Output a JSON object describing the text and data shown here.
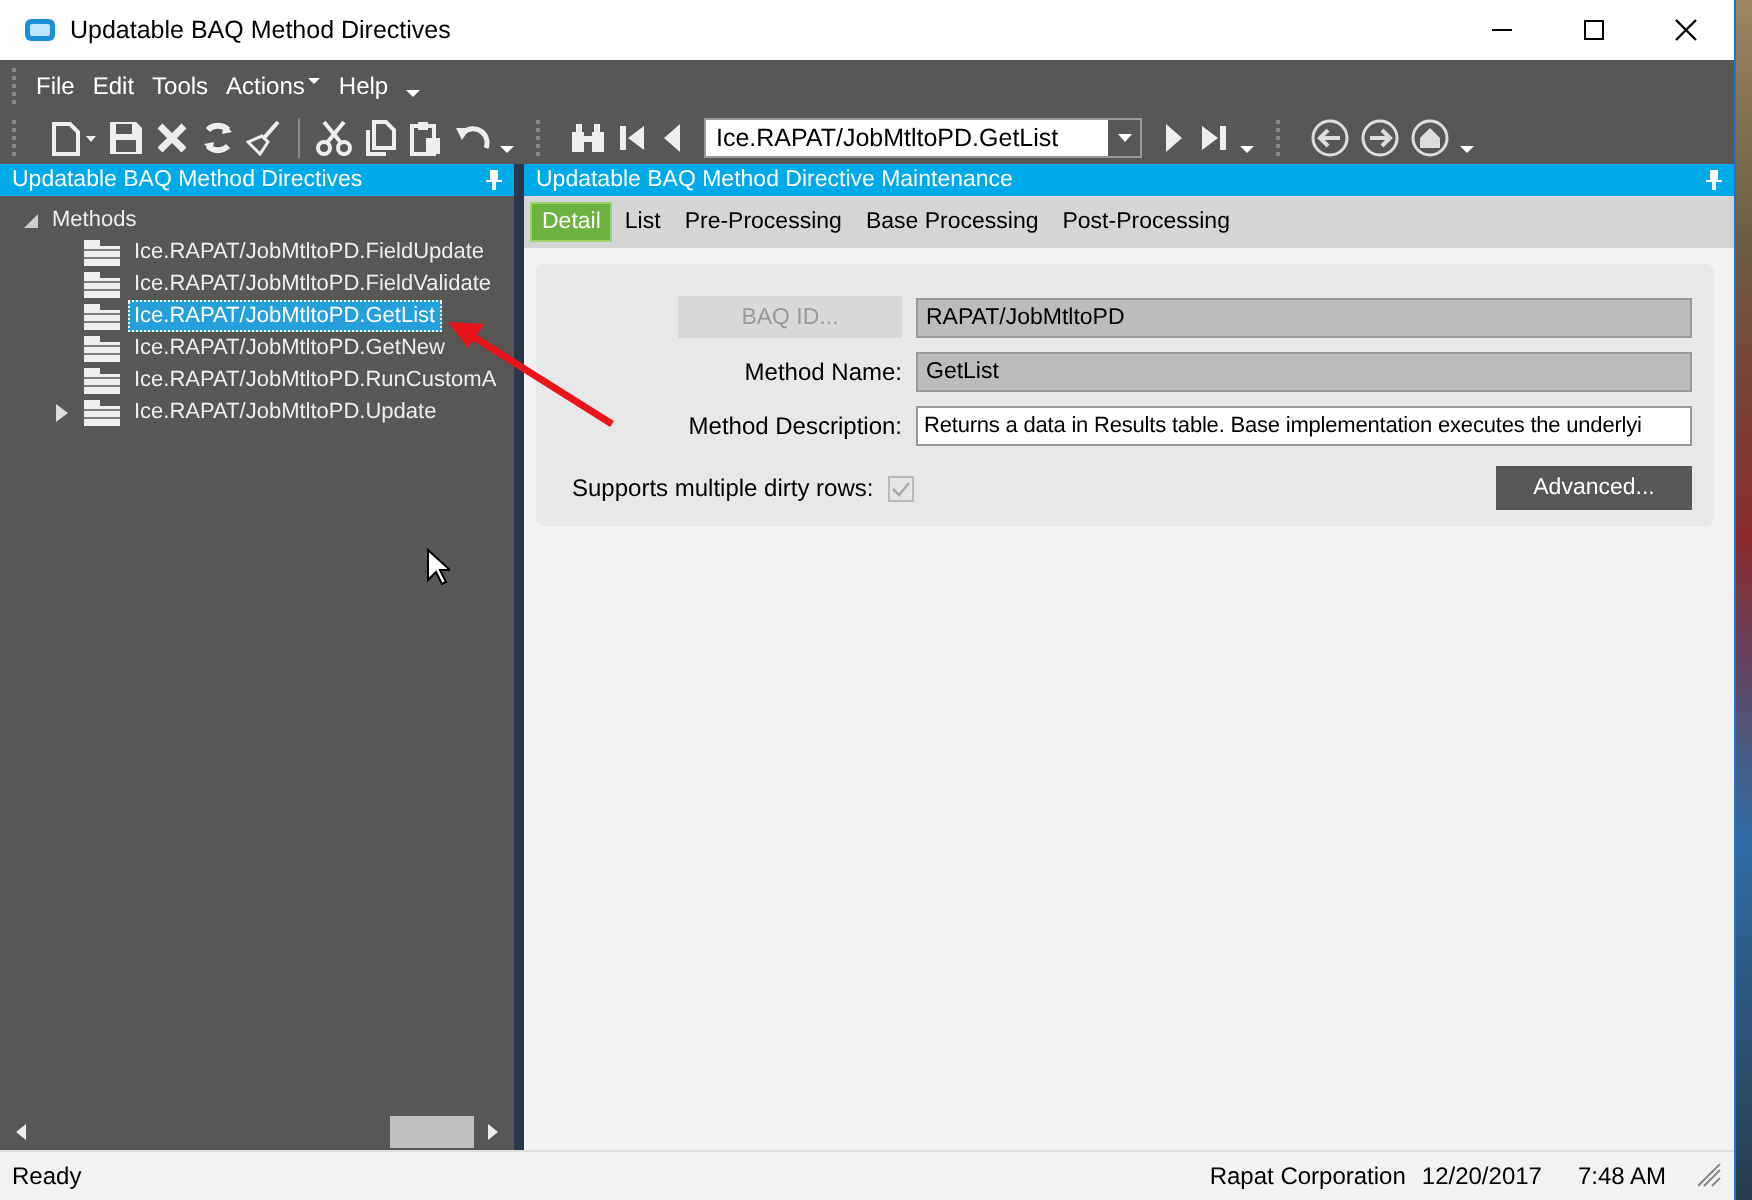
{
  "window": {
    "title": "Updatable BAQ Method Directives"
  },
  "menu": [
    {
      "label": "File",
      "dropdown": false
    },
    {
      "label": "Edit",
      "dropdown": false
    },
    {
      "label": "Tools",
      "dropdown": false
    },
    {
      "label": "Actions",
      "dropdown": true
    },
    {
      "label": "Help",
      "dropdown": false
    }
  ],
  "toolbar": {
    "record_combo": "Ice.RAPAT/JobMtltoPD.GetList"
  },
  "left_panel": {
    "title": "Updatable BAQ Method Directives",
    "tree": {
      "label": "Methods",
      "expanded": true,
      "children": [
        {
          "label": "Ice.RAPAT/JobMtltoPD.FieldUpdate",
          "selected": false,
          "expandable": false
        },
        {
          "label": "Ice.RAPAT/JobMtltoPD.FieldValidate",
          "selected": false,
          "expandable": false
        },
        {
          "label": "Ice.RAPAT/JobMtltoPD.GetList",
          "selected": true,
          "expandable": false
        },
        {
          "label": "Ice.RAPAT/JobMtltoPD.GetNew",
          "selected": false,
          "expandable": false
        },
        {
          "label": "Ice.RAPAT/JobMtltoPD.RunCustomA",
          "selected": false,
          "expandable": false
        },
        {
          "label": "Ice.RAPAT/JobMtltoPD.Update",
          "selected": false,
          "expandable": true
        }
      ]
    }
  },
  "right_panel": {
    "title": "Updatable BAQ Method Directive Maintenance",
    "tabs": [
      {
        "label": "Detail",
        "selected": true
      },
      {
        "label": "List",
        "selected": false
      },
      {
        "label": "Pre-Processing",
        "selected": false
      },
      {
        "label": "Base Processing",
        "selected": false
      },
      {
        "label": "Post-Processing",
        "selected": false
      }
    ],
    "form": {
      "baq_id_button": {
        "label": "BAQ ID...",
        "disabled": true
      },
      "baq_id": {
        "value": "RAPAT/JobMtltoPD",
        "disabled": true
      },
      "method_name": {
        "label": "Method Name:",
        "value": "GetList",
        "disabled": true
      },
      "method_description": {
        "label": "Method Description:",
        "value": "Returns a data in Results table. Base implementation executes the underlyi",
        "disabled": false
      },
      "supports_dirty_rows": {
        "label": "Supports multiple dirty rows:",
        "checked": true,
        "disabled": true
      },
      "advanced_button": "Advanced..."
    }
  },
  "status_bar": {
    "status": "Ready",
    "company": "Rapat Corporation",
    "date": "12/20/2017",
    "time": "7:48 AM"
  }
}
